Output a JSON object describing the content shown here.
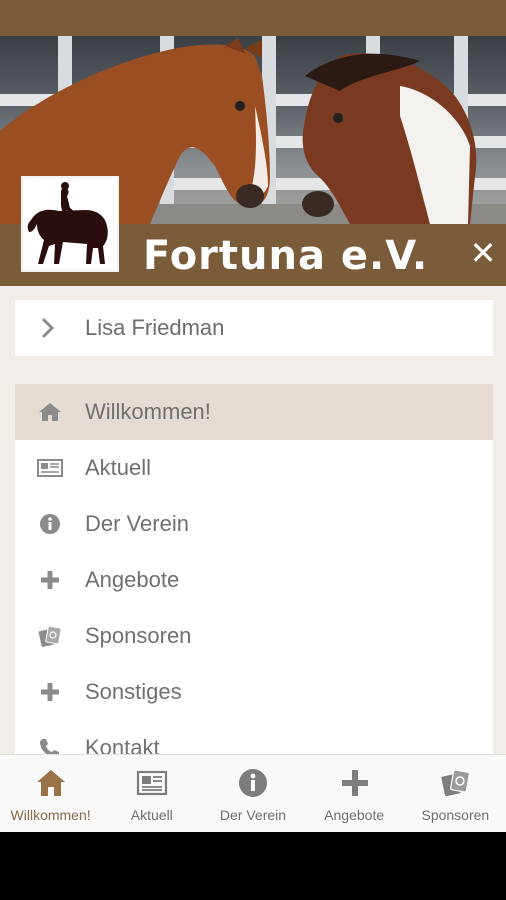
{
  "app": {
    "title": "Fortuna e.V."
  },
  "colors": {
    "brand": "#7a5c3b",
    "accent": "#8a6a45",
    "active_row": "#e4dcd3",
    "icon_gray": "#8b8b8b"
  },
  "header": {
    "close_icon": "close-icon",
    "logo": "rider-on-horse-logo"
  },
  "user": {
    "name": "Lisa Friedman",
    "icon": "chevron-right-icon"
  },
  "menu": {
    "items": [
      {
        "label": "Willkommen!",
        "icon": "home-icon",
        "active": true
      },
      {
        "label": "Aktuell",
        "icon": "newspaper-icon",
        "active": false
      },
      {
        "label": "Der Verein",
        "icon": "info-icon",
        "active": false
      },
      {
        "label": "Angebote",
        "icon": "plus-icon",
        "active": false
      },
      {
        "label": "Sponsoren",
        "icon": "sponsor-cards-icon",
        "active": false
      },
      {
        "label": "Sonstiges",
        "icon": "plus-icon",
        "active": false
      },
      {
        "label": "Kontakt",
        "icon": "phone-icon",
        "active": false
      }
    ]
  },
  "tabs": [
    {
      "label": "Willkommen!",
      "icon": "home-icon",
      "active": true
    },
    {
      "label": "Aktuell",
      "icon": "newspaper-icon",
      "active": false
    },
    {
      "label": "Der Verein",
      "icon": "info-icon",
      "active": false
    },
    {
      "label": "Angebote",
      "icon": "plus-icon",
      "active": false
    },
    {
      "label": "Sponsoren",
      "icon": "sponsor-cards-icon",
      "active": false
    }
  ]
}
